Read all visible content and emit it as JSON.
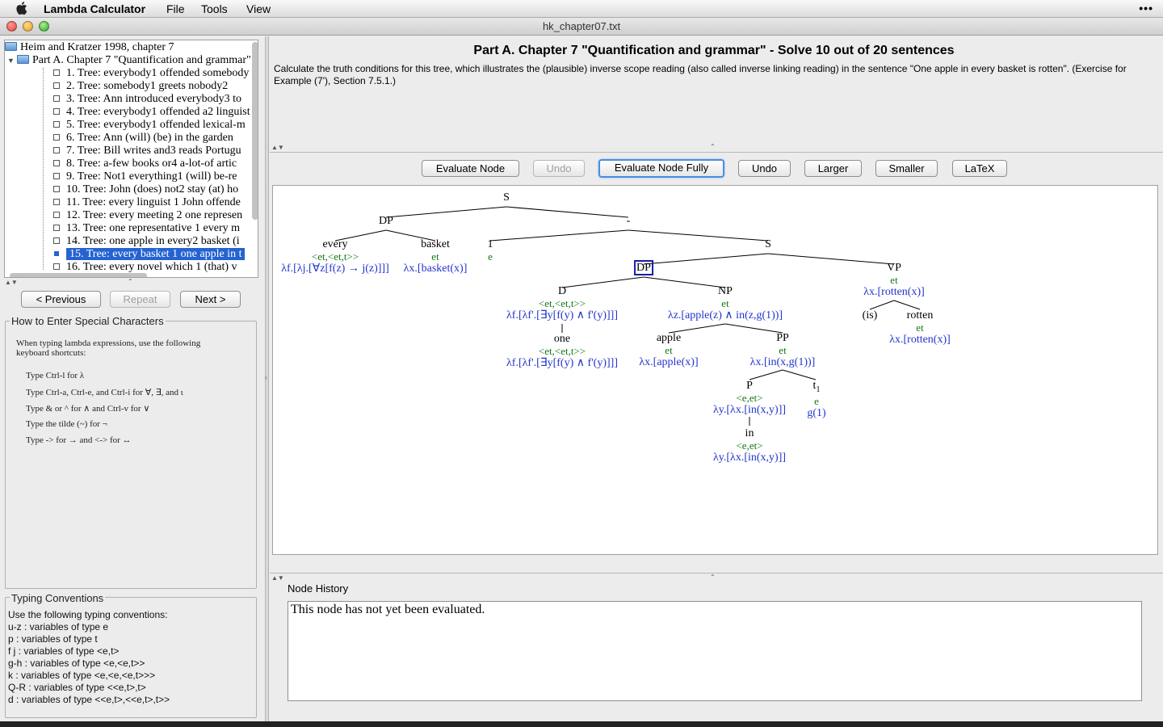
{
  "menubar": {
    "app_name": "Lambda Calculator",
    "items": [
      "File",
      "Tools",
      "View"
    ],
    "extras": "•••"
  },
  "window": {
    "title": "hk_chapter07.txt"
  },
  "sidebar": {
    "root": "Heim and Kratzer 1998, chapter 7",
    "part": "Part A. Chapter 7 \"Quantification and grammar\"",
    "items": [
      "1. Tree: everybody1 offended somebody",
      "2. Tree: somebody1 greets nobody2",
      "3. Tree: Ann introduced everybody3 to",
      "4. Tree: everybody1 offended a2 linguist",
      "5. Tree: everybody1 offended lexical-m",
      "6. Tree: Ann (will) (be) in the garden",
      "7. Tree: Bill writes and3 reads Portugu",
      "8. Tree: a-few books or4 a-lot-of artic",
      "9. Tree: Not1 everything1 (will) be-re",
      "10. Tree: John (does) not2 stay (at) ho",
      "11. Tree: every linguist 1 John offende",
      "12. Tree: every meeting 2 one represen",
      "13. Tree: one representative 1 every m",
      "14. Tree: one apple in every2 basket (i",
      "15. Tree: every basket 1 one apple in t",
      "16. Tree: every novel which 1 (that) v"
    ],
    "selected_index": 14
  },
  "nav": {
    "previous": "< Previous",
    "repeat": "Repeat",
    "next": "Next >"
  },
  "special_chars": {
    "title": "How to Enter Special Characters",
    "intro_1": "When typing lambda expressions, use the following",
    "intro_2": "keyboard shortcuts:",
    "lines": [
      "Type Ctrl-l for λ",
      "Type Ctrl-a, Ctrl-e, and Ctrl-i for ∀, ∃, and ι",
      "Type & or ^ for ∧ and Ctrl-v for ∨",
      "Type the tilde (~) for ¬",
      "Type -> for → and <-> for ↔"
    ]
  },
  "conventions": {
    "title": "Typing Conventions",
    "lines": [
      "Use the following typing conventions:",
      "u-z : variables of type e",
      "p : variables of type t",
      "f j : variables of type <e,t>",
      "g-h : variables of type <e,<e,t>>",
      "k : variables of type <e,<e,<e,t>>>",
      "Q-R : variables of type <<e,t>,t>",
      "d : variables of type <<e,t>,<<e,t>,t>>"
    ]
  },
  "problem": {
    "title": "Part A. Chapter 7 \"Quantification and grammar\" - Solve 10 out of 20 sentences",
    "description": "Calculate the truth conditions for this tree, which illustrates the (plausible) inverse scope reading (also called inverse linking reading) in the sentence \"One apple in every basket is rotten\". (Exercise for Example (7'), Section 7.5.1.)"
  },
  "toolbar": {
    "evaluate_node": "Evaluate Node",
    "undo_1": "Undo",
    "evaluate_fully": "Evaluate Node Fully",
    "undo_2": "Undo",
    "larger": "Larger",
    "smaller": "Smaller",
    "latex": "LaTeX"
  },
  "tree": {
    "s_root": "S",
    "dp_top": "DP",
    "dash": "-",
    "every": "every",
    "every_type": "<et,<et,t>>",
    "every_lam": "λf.[λj.[∀z[f(z) → j(z)]]]",
    "basket": "basket",
    "basket_type": "et",
    "basket_lam": "λx.[basket(x)]",
    "one_idx": "1",
    "one_idx_type": "e",
    "s_inner": "S",
    "dp_sel": "DP",
    "vp": "VP",
    "vp_type": "et",
    "vp_lam": "λx.[rotten(x)]",
    "d": "D",
    "d_type": "<et,<et,t>>",
    "d_lam": "λf.[λf'.[∃y[f(y) ∧ f'(y)]]]",
    "one": "one",
    "one_type": "<et,<et,t>>",
    "one_lam": "λf.[λf'.[∃y[f(y) ∧ f'(y)]]]",
    "np": "NP",
    "np_type": "et",
    "np_lam": "λz.[apple(z) ∧ in(z,g(1))]",
    "apple": "apple",
    "apple_type": "et",
    "apple_lam": "λx.[apple(x)]",
    "pp": "PP",
    "pp_type": "et",
    "pp_lam": "λx.[in(x,g(1))]",
    "p": "P",
    "p_type": "<e,et>",
    "p_lam": "λy.[λx.[in(x,y)]]",
    "in": "in",
    "in_type": "<e,et>",
    "in_lam": "λy.[λx.[in(x,y)]]",
    "t": "t",
    "t_sub": "1",
    "t_type": "e",
    "t_val": "g(1)",
    "is": "(is)",
    "rotten": "rotten",
    "rotten_type": "et",
    "rotten_lam": "λx.[rotten(x)]"
  },
  "history": {
    "label": "Node History",
    "text": "This node has not yet been evaluated."
  },
  "colors": {
    "type": "#117711",
    "lambda": "#2233cc",
    "selection": "#2563d0"
  }
}
